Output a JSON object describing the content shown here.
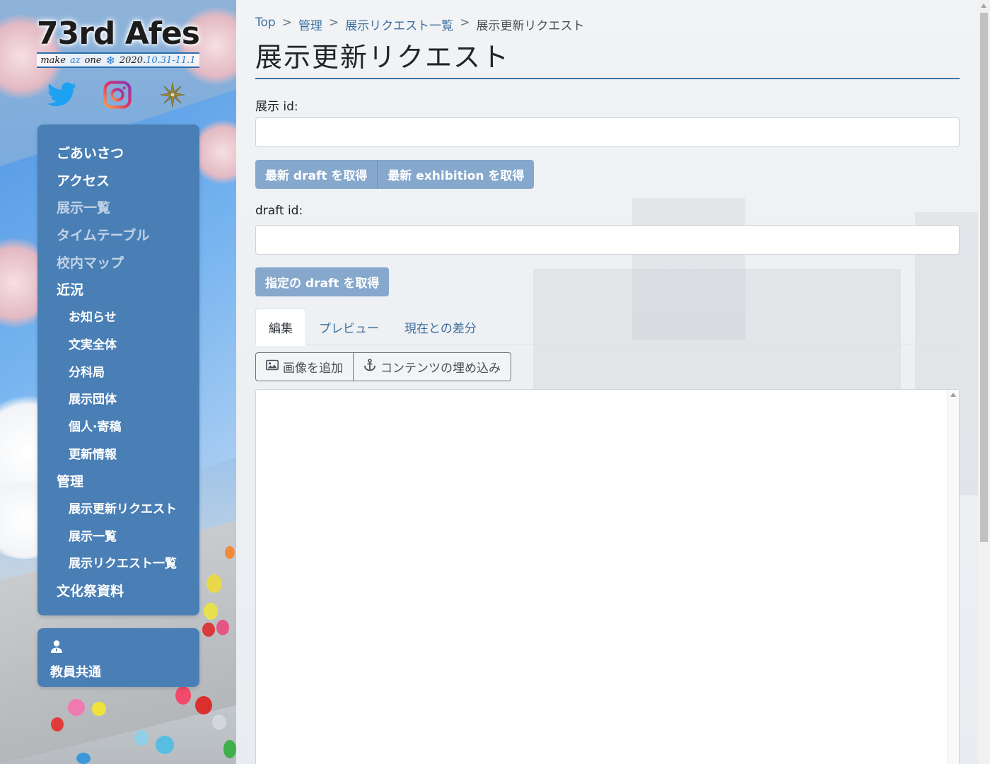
{
  "logo": {
    "title": "73rd Afes",
    "tagline_make": "make",
    "tagline_az": "az",
    "tagline_one": "one",
    "tagline_date_prefix": "2020.",
    "tagline_date_rest": "10.31-11.1"
  },
  "social": [
    "twitter-icon",
    "instagram-icon",
    "emblem-icon"
  ],
  "sidebar": {
    "items": [
      {
        "label": "ごあいさつ",
        "level": 0,
        "dim": false
      },
      {
        "label": "アクセス",
        "level": 0,
        "dim": false
      },
      {
        "label": "展示一覧",
        "level": 0,
        "dim": true
      },
      {
        "label": "タイムテーブル",
        "level": 0,
        "dim": true
      },
      {
        "label": "校内マップ",
        "level": 0,
        "dim": true
      },
      {
        "label": "近況",
        "level": 0,
        "dim": false
      },
      {
        "label": "お知らせ",
        "level": 1,
        "dim": false
      },
      {
        "label": "文実全体",
        "level": 1,
        "dim": false
      },
      {
        "label": "分科局",
        "level": 1,
        "dim": false
      },
      {
        "label": "展示団体",
        "level": 1,
        "dim": false
      },
      {
        "label": "個人·寄稿",
        "level": 1,
        "dim": false
      },
      {
        "label": "更新情報",
        "level": 1,
        "dim": false
      },
      {
        "label": "管理",
        "level": 0,
        "dim": false
      },
      {
        "label": "展示更新リクエスト",
        "level": 1,
        "dim": false
      },
      {
        "label": "展示一覧",
        "level": 1,
        "dim": false
      },
      {
        "label": "展示リクエスト一覧",
        "level": 1,
        "dim": false
      },
      {
        "label": "文化祭資料",
        "level": 0,
        "dim": false
      }
    ],
    "teacher_label": "教員共通"
  },
  "breadcrumb": {
    "items": [
      "Top",
      "管理",
      "展示リクエスト一覧"
    ],
    "current": "展示更新リクエスト",
    "separator": ">"
  },
  "page_title": "展示更新リクエスト",
  "form": {
    "exhibit_id_label": "展示 id:",
    "exhibit_id_value": "",
    "btn_latest_draft": "最新 draft を取得",
    "btn_latest_exhibition": "最新 exhibition を取得",
    "draft_id_label": "draft id:",
    "draft_id_value": "",
    "btn_specified_draft": "指定の draft を取得"
  },
  "tabs": [
    "編集",
    "プレビュー",
    "現在との差分"
  ],
  "toolbar": {
    "add_image": "画像を追加",
    "embed_content": "コンテンツの埋め込み"
  },
  "colors": {
    "menu_bg": "#4a7fb6",
    "button_bg": "#85a8cc",
    "link": "#3d6e9f",
    "title_rule": "#3f74ab"
  }
}
